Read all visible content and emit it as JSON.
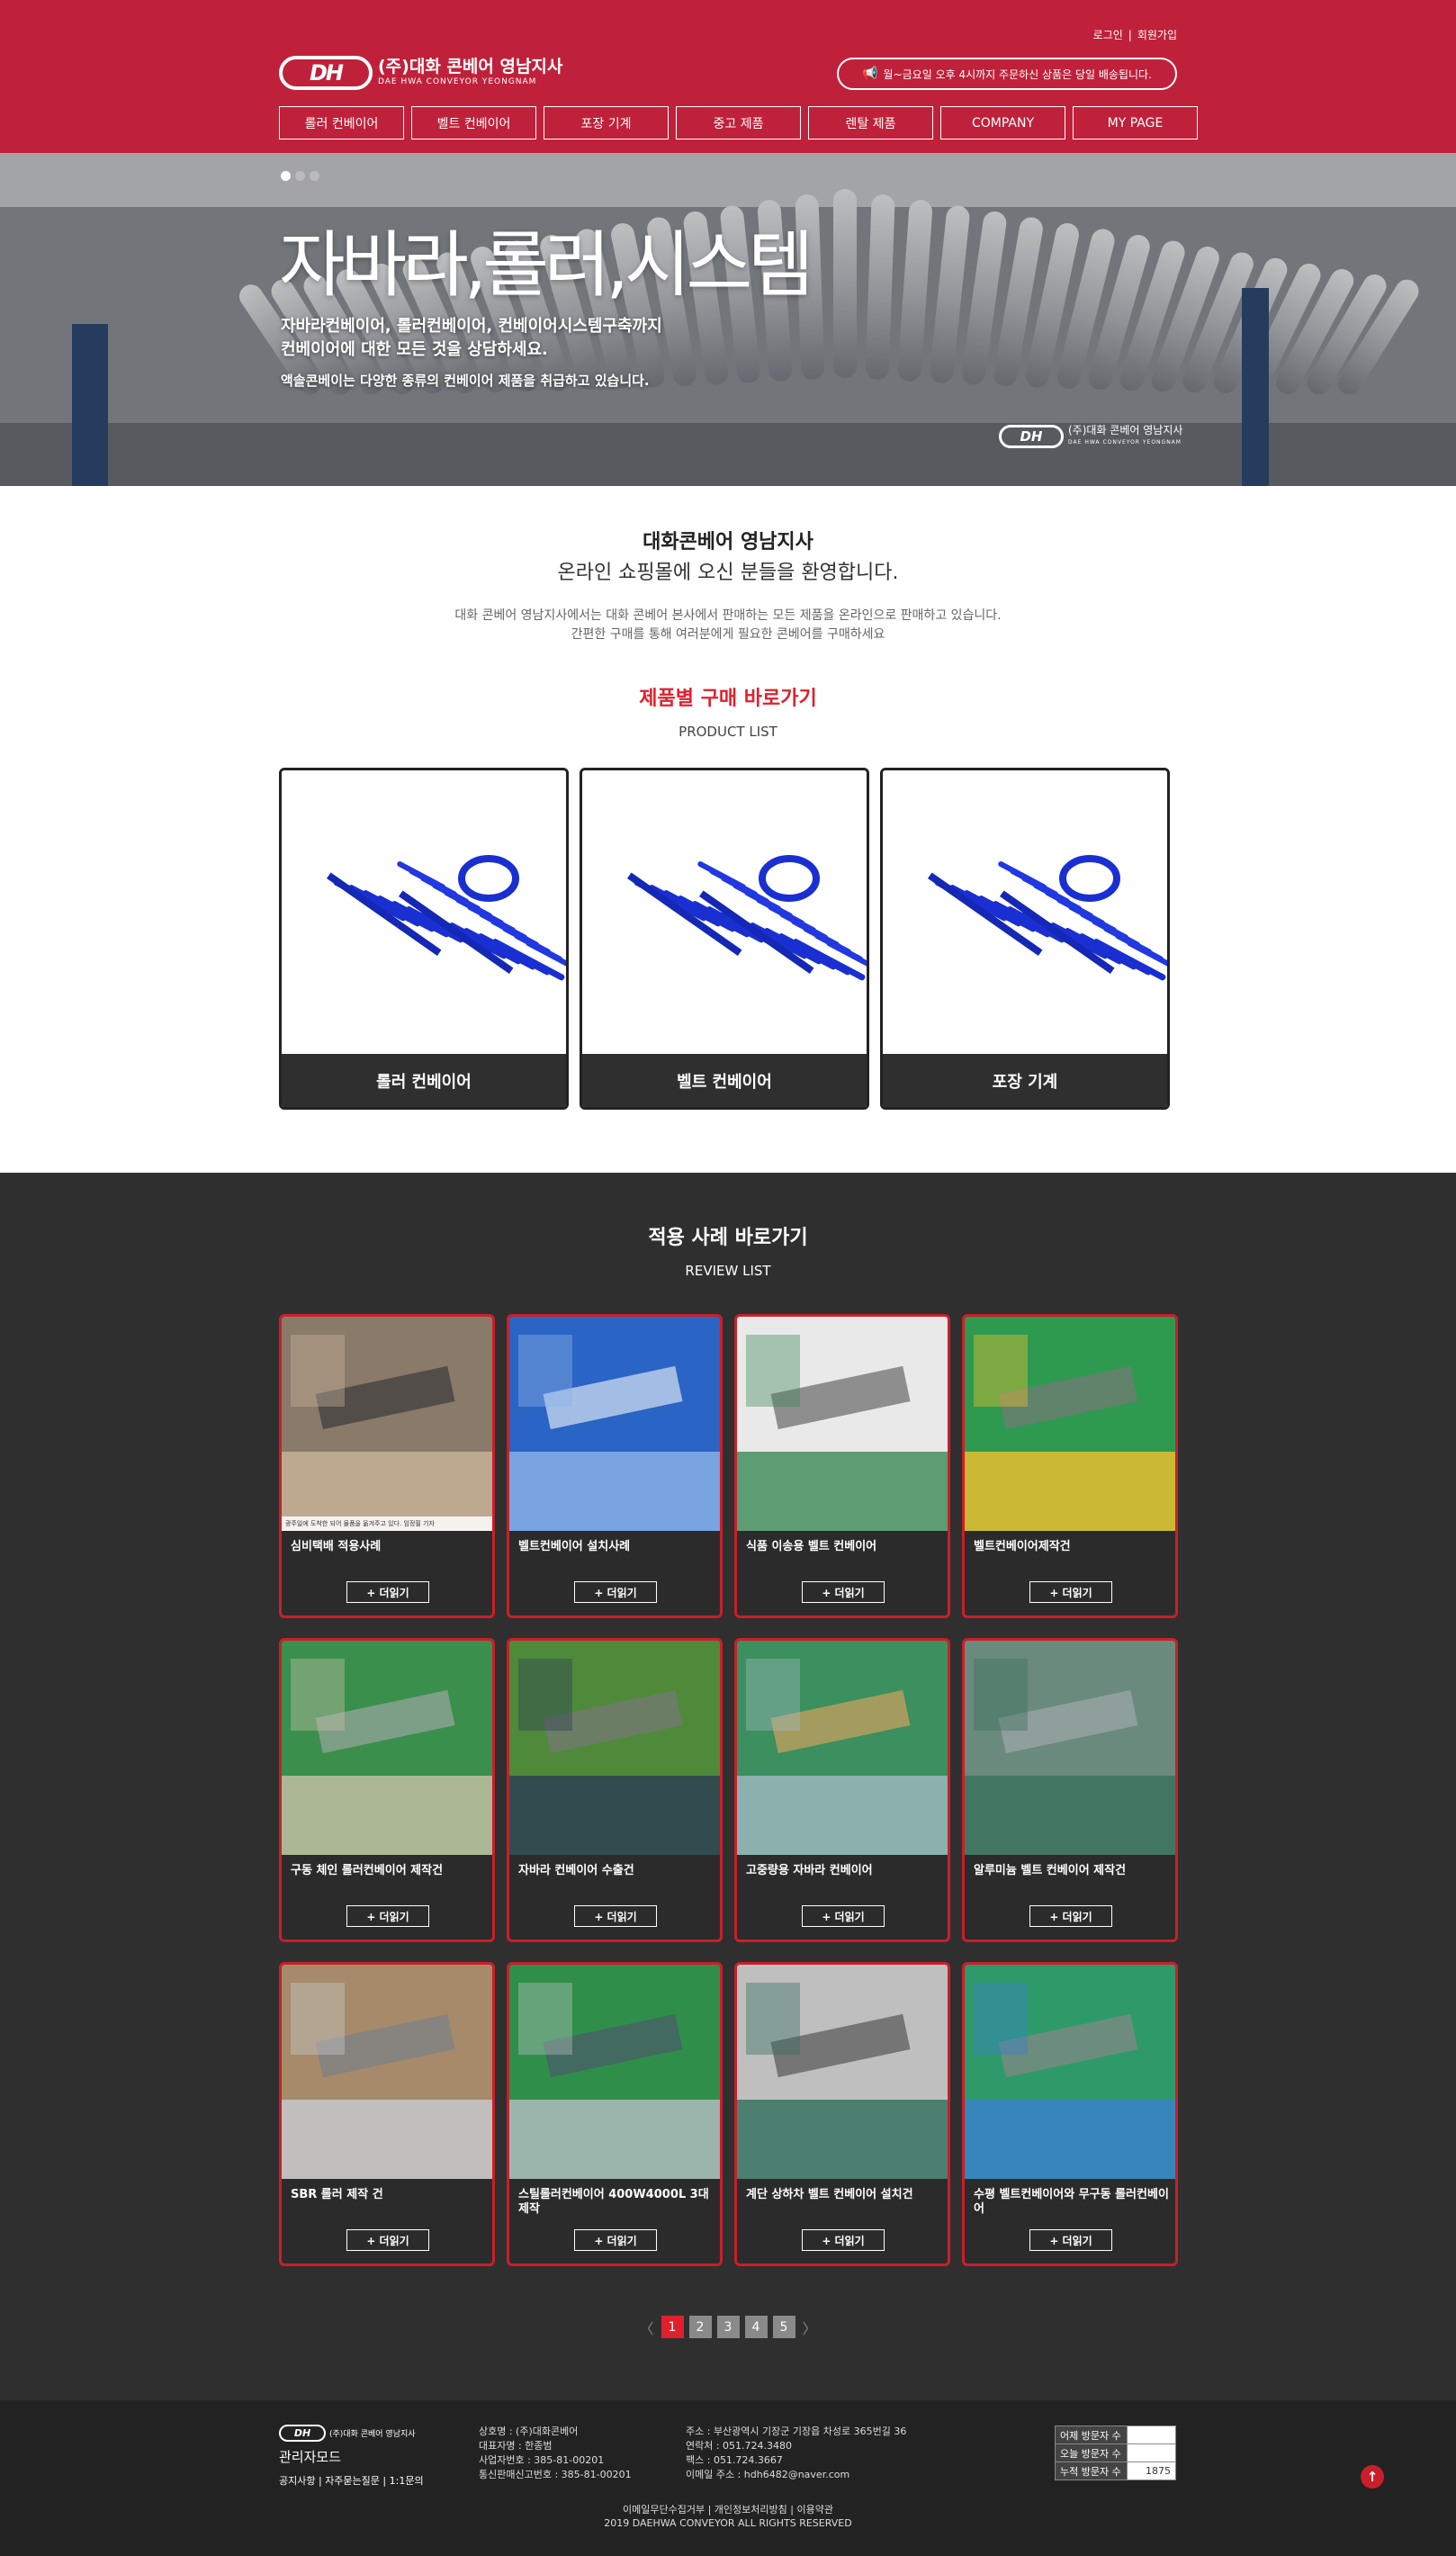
{
  "header": {
    "login": "로그인",
    "join": "회원가입",
    "logo_mark": "DH",
    "logo_name": "(주)대화 콘베어 영남지사",
    "logo_en": "DAE HWA CONVEYOR YEONGNAM",
    "notice": "월~금요일 오후 4시까지 주문하신 상품은 당일 배송됩니다.",
    "nav": [
      "롤러 컨베이어",
      "벨트 컨베이어",
      "포장 기계",
      "중고 제품",
      "렌탈 제품",
      "COMPANY",
      "MY PAGE"
    ]
  },
  "hero": {
    "title": "자바라,롤러,시스템",
    "sub1": "자바라컨베이어, 롤러컨베이어, 컨베이어시스템구축까지",
    "sub2": "컨베이어에 대한 모든 것을 상담하세요.",
    "sub3": "액솔콘베이는 다양한 종류의 컨베이어 제품을 취급하고 있습니다.",
    "logo_name": "(주)대화 콘베어 영남지사",
    "logo_en": "DAE HWA CONVEYOR YEONGNAM"
  },
  "intro": {
    "title": "대화콘베어 영남지사",
    "subtitle": "온라인 쇼핑몰에 오신 분들을 환영합니다.",
    "desc1": "대화 콘베어 영남지사에서는 대화 콘베어 본사에서 판매하는 모든 제품을 온라인으로 판매하고 있습니다.",
    "desc2": "간편한 구매를 통해 여러분에게 필요한 콘베어를 구매하세요"
  },
  "products": {
    "title": "제품별 구매 바로가기",
    "subtitle": "PRODUCT LIST",
    "items": [
      "롤러 컨베이어",
      "벨트 컨베이어",
      "포장 기계"
    ]
  },
  "review": {
    "title": "적용 사례 바로가기",
    "subtitle": "REVIEW LIST",
    "more_label": "+ 더읽기",
    "first_caption": "광주일에 도착한 되어 물품을 옮겨주고 있다. 임정필 기자",
    "items": [
      "심비택배 적용사례",
      "벨트컨베이어 설치사례",
      "식품 이송용 벨트 컨베이어",
      "벨트컨베이어제작건",
      "구동 체인 롤러컨베이어 제작건",
      "자바라 컨베이어 수출건",
      "고중량용 자바라 컨베이어",
      "알루미늄 벨트 컨베이어 제작건",
      "SBR 롤러 제작 건",
      "스틸롤러컨베이어 400W4000L 3대 제작",
      "계단 상하차 벨트 컨베이어 설치건",
      "수평 벨트컨베이어와 무구동 롤러컨베이어"
    ],
    "pages": [
      "1",
      "2",
      "3",
      "4",
      "5"
    ],
    "current_page": "1"
  },
  "footer": {
    "logo_mark": "DH",
    "logo_name": "(주)대화 콘베어 영남지사",
    "admin": "관리자모드",
    "links": [
      "공지사항",
      "자주묻는질문",
      "1:1문의"
    ],
    "col1": [
      "상호명 : (주)대화콘베어",
      "대표자명 : 한종범",
      "사업자번호 : 385-81-00201",
      "통신판매신고번호 : 385-81-00201"
    ],
    "col2": [
      "주소 : 부산광역시 기장군 기장읍 차성로 365번길 36",
      "연락처 : 051.724.3480",
      "팩스 : 051.724.3667",
      "이메일 주소 : hdh6482@naver.com"
    ],
    "visit_labels": [
      "어제 방문자 수",
      "오늘 방문자 수",
      "누적 방문자 수"
    ],
    "visit_values": [
      "",
      "",
      "1875"
    ],
    "bottom_links": "이메일무단수집거부  |  개인정보처리방침  |  이용약관",
    "copyright": "2019 DAEHWA CONVEYOR ALL RIGHTS RESERVED"
  },
  "colors": {
    "brand": "#c0213a",
    "accent_red": "#e0202e",
    "dark": "#2f2f2f"
  }
}
